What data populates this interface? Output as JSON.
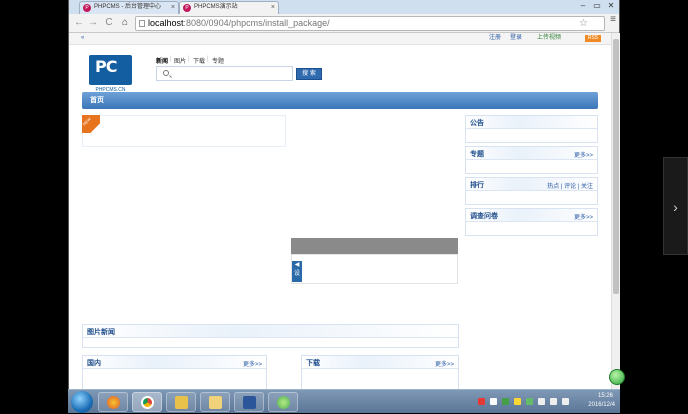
{
  "browser": {
    "tabs": [
      {
        "label": "PHPCMS - 后台管理中心",
        "active": false
      },
      {
        "label": "PHPCMS演示站",
        "active": true
      }
    ],
    "window_controls": {
      "min": "–",
      "max": "▭",
      "close": "✕"
    },
    "address": {
      "host": "localhost",
      "rest": ":8080/0904/phpcms/install_package/"
    },
    "nav": {
      "back": "←",
      "forward": "→",
      "reload": "C",
      "home": "⌂"
    },
    "star": "☆",
    "menu": "≡"
  },
  "site": {
    "top_strip": {
      "note": "«",
      "links": [
        "注册",
        "登录",
        "上传视频"
      ],
      "rss": "RSS"
    },
    "logo": {
      "text": "PC",
      "subtitle": "PHPCMS.CN"
    },
    "search": {
      "tabs": [
        "新闻",
        "图片",
        "下载",
        "专题"
      ],
      "placeholder": "",
      "button": "搜 索"
    },
    "nav": {
      "home": "首页"
    },
    "ribbon": "NEW",
    "slide_ctrl": "◀ 设",
    "right_boxes": [
      {
        "title": "公告",
        "more": ""
      },
      {
        "title": "专题",
        "more": "更多>>"
      },
      {
        "title": "排行",
        "more": "热点 | 评论 | 关注"
      },
      {
        "title": "调查问卷",
        "more": "更多>>"
      }
    ],
    "picture_news": {
      "title": "图片新闻"
    },
    "bottom_boxes": [
      {
        "title": "国内",
        "more": "更多>>"
      },
      {
        "title": "下载",
        "more": "更多>>"
      }
    ]
  },
  "taskbar": {
    "clock": {
      "time": "15:26",
      "date": "2016/12/4"
    }
  },
  "colors": {
    "accent": "#3c76b9",
    "brand": "#135ea0",
    "ribbon": "#e8731d"
  }
}
